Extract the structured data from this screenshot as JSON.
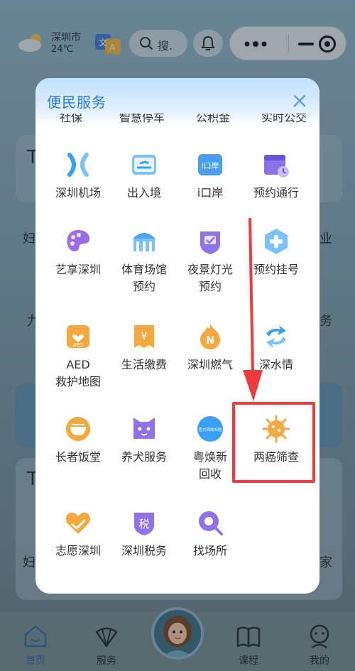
{
  "topbar": {
    "weather": {
      "city": "深圳市",
      "temp": "24℃"
    },
    "search_placeholder": "搜.",
    "icons": [
      "cloud-icon",
      "translate-icon",
      "search-icon",
      "bell-icon",
      "more-dots-icon",
      "minimize-icon",
      "target-icon"
    ]
  },
  "background_fragments": [
    "T",
    "妇",
    "业",
    "九",
    "务",
    "T",
    "妇",
    "家"
  ],
  "modal": {
    "title": "便民服务",
    "partial_row": [
      "社保",
      "智慧停车",
      "公积金",
      "实时公交"
    ],
    "items": [
      {
        "label": "深圳机场",
        "icon": "airport-icon",
        "color": "#3aa0f5"
      },
      {
        "label": "出入境",
        "icon": "boarding-pass-icon",
        "color": "#4aa8f0"
      },
      {
        "label": "i口岸",
        "icon": "port-icon",
        "color": "#4a9ef2"
      },
      {
        "label": "预约通行",
        "icon": "calendar-pass-icon",
        "color": "#8a72e8"
      },
      {
        "label": "艺享深圳",
        "icon": "palette-icon",
        "color": "#9a6ce6"
      },
      {
        "label": "体育场馆\n预约",
        "icon": "stadium-icon",
        "color": "#4aa6f2"
      },
      {
        "label": "夜景灯光\n预约",
        "icon": "night-light-icon",
        "color": "#8e72ea"
      },
      {
        "label": "预约挂号",
        "icon": "medical-cross-icon",
        "color": "#4aa8f0"
      },
      {
        "label": "AED\n救护地图",
        "icon": "aed-icon",
        "color": "#f3a93d"
      },
      {
        "label": "生活缴费",
        "icon": "yuan-bill-icon",
        "color": "#f3a93d"
      },
      {
        "label": "深圳燃气",
        "icon": "gas-flame-icon",
        "color": "#f3a93d"
      },
      {
        "label": "深水情",
        "icon": "water-cycle-icon",
        "color": "#3aa0f5"
      },
      {
        "label": "长者饭堂",
        "icon": "elderly-canteen-icon",
        "color": "#f3a93d"
      },
      {
        "label": "养犬服务",
        "icon": "dog-icon",
        "color": "#8e72ea"
      },
      {
        "label": "粤焕新\n回收",
        "icon": "recycle-badge-icon",
        "color": "#3aa0f5"
      },
      {
        "label": "两癌筛查",
        "icon": "cancer-screening-icon",
        "color": "#f3a93d"
      },
      {
        "label": "志愿深圳",
        "icon": "volunteer-heart-icon",
        "color": "#f3a93d"
      },
      {
        "label": "深圳税务",
        "icon": "tax-icon",
        "color": "#8e72ea"
      },
      {
        "label": "找场所",
        "icon": "location-search-icon",
        "color": "#8e72ea"
      }
    ],
    "badge_texts": {
      "aed": "AED",
      "tax": "税",
      "port": "i口岸",
      "recycle": "官方回收补贴"
    }
  },
  "tabbar": [
    {
      "label": "首页",
      "icon": "home-icon",
      "active": true
    },
    {
      "label": "服务",
      "icon": "fan-service-icon",
      "active": false
    },
    {
      "label": "课程",
      "icon": "book-icon",
      "active": false
    },
    {
      "label": "我的",
      "icon": "profile-icon",
      "active": false
    }
  ],
  "annotation": {
    "highlight_color": "#ee3b3b"
  }
}
